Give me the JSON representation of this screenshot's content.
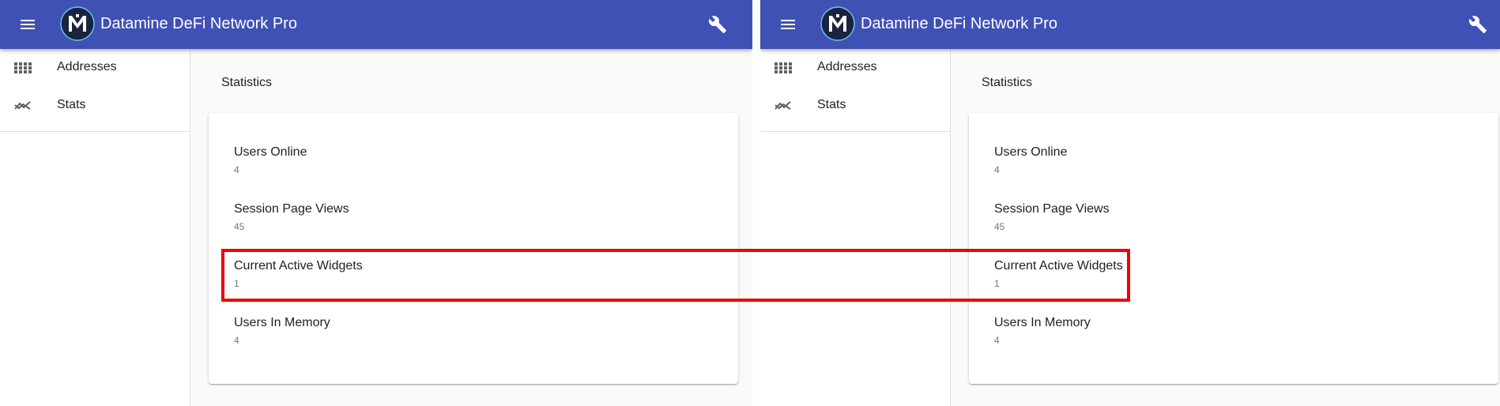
{
  "app": {
    "title": "Datamine DeFi Network Pro",
    "logo_letter": "M"
  },
  "icons": {
    "menu": "menu-icon",
    "wrench": "wrench-icon",
    "addresses": "grid-icon",
    "stats": "trending-icon"
  },
  "sidebar": {
    "items": [
      {
        "label": "Addresses",
        "icon": "grid-icon"
      },
      {
        "label": "Stats",
        "icon": "trending-icon"
      }
    ]
  },
  "content": {
    "title": "Statistics",
    "stats": [
      {
        "label": "Users Online",
        "value": "4"
      },
      {
        "label": "Session Page Views",
        "value": "45"
      },
      {
        "label": "Current Active Widgets",
        "value": "1"
      },
      {
        "label": "Users In Memory",
        "value": "4"
      }
    ]
  },
  "colors": {
    "appbar": "#3f51b5",
    "highlight": "#ee0000",
    "background": "#fafafa"
  }
}
